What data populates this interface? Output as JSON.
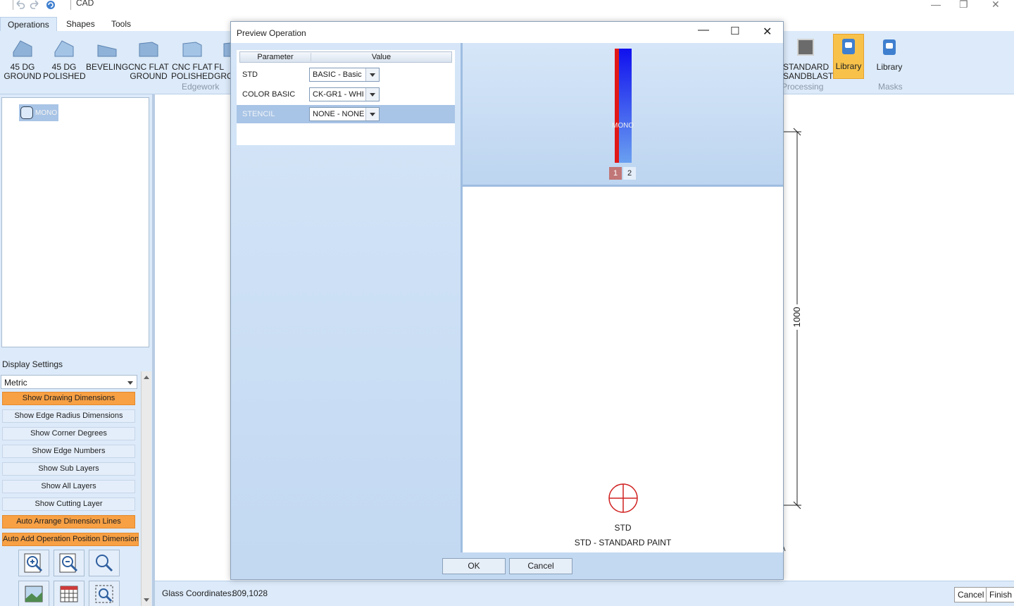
{
  "app": {
    "title": "CAD",
    "tabs": [
      "Operations",
      "Shapes",
      "Tools"
    ]
  },
  "ribbon": {
    "edgework": [
      "45 DG\nGROUND",
      "45 DG\nPOLISHED",
      "BEVELING",
      "CNC FLAT\nGROUND",
      "CNC FLAT\nPOLISHED",
      "FL\nGRO"
    ],
    "edgework_label": "Edgework",
    "processing_button": "STANDARD\nSANDBLAST",
    "processing_label": "Processing",
    "library_button": "Library",
    "masks_library_button": "Library",
    "masks_label": "Masks",
    "accent": "#f8c24a"
  },
  "tree": {
    "item_label": "MONO"
  },
  "display_settings": {
    "title": "Display Settings",
    "unit": "Metric",
    "options": [
      {
        "label": "Show Drawing Dimensions",
        "on": true
      },
      {
        "label": "Show Edge Radius Dimensions",
        "on": false
      },
      {
        "label": "Show Corner Degrees",
        "on": false
      },
      {
        "label": "Show Edge Numbers",
        "on": false
      },
      {
        "label": "Show Sub Layers",
        "on": false
      },
      {
        "label": "Show All Layers",
        "on": false
      },
      {
        "label": "Show Cutting Layer",
        "on": false
      },
      {
        "label": "Auto Arrange Dimension Lines",
        "on": true
      },
      {
        "label": "Auto Add Operation Position Dimension",
        "on": true
      }
    ]
  },
  "canvas": {
    "dimension_label": "1000"
  },
  "status": {
    "coords_label": "Glass Coordinates:",
    "coords_value": "809,1028",
    "cancel": "Cancel",
    "finish": "Finish"
  },
  "dialog": {
    "title": "Preview Operation",
    "col_parameter": "Parameter",
    "col_value": "Value",
    "rows": [
      {
        "name": "STD",
        "value": "BASIC - Basic"
      },
      {
        "name": "COLOR BASIC",
        "value": "CK-GR1 - WHI"
      },
      {
        "name": "STENCIL",
        "value": "NONE - NONE"
      }
    ],
    "preview_label": "MONO",
    "pages": [
      "1",
      "2"
    ],
    "op_code": "STD",
    "op_desc": "STD - STANDARD PAINT",
    "ok": "OK",
    "cancel": "Cancel"
  }
}
